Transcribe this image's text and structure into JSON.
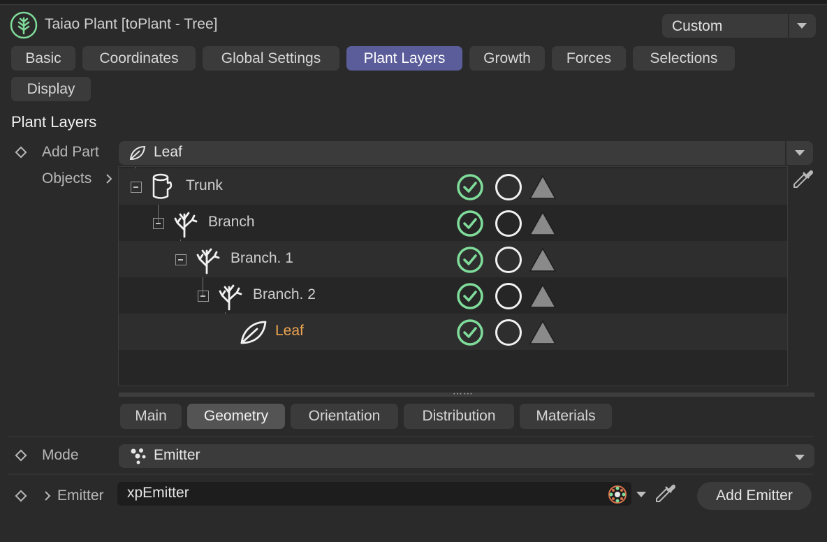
{
  "header": {
    "title": "Taiao Plant [toPlant - Tree]",
    "preset": "Custom"
  },
  "tabs": [
    {
      "label": "Basic",
      "active": false
    },
    {
      "label": "Coordinates",
      "active": false
    },
    {
      "label": "Global Settings",
      "active": false
    },
    {
      "label": "Plant Layers",
      "active": true
    },
    {
      "label": "Growth",
      "active": false
    },
    {
      "label": "Forces",
      "active": false
    },
    {
      "label": "Selections",
      "active": false
    },
    {
      "label": "Display",
      "active": false
    }
  ],
  "section": {
    "title": "Plant Layers"
  },
  "add_part": {
    "label": "Add Part",
    "value": "Leaf"
  },
  "objects": {
    "label": "Objects",
    "items": [
      {
        "name": "Trunk",
        "icon": "trunk-icon",
        "selected": false
      },
      {
        "name": "Branch",
        "icon": "branch-icon",
        "selected": false
      },
      {
        "name": "Branch. 1",
        "icon": "branch-icon",
        "selected": false
      },
      {
        "name": "Branch. 2",
        "icon": "branch-icon",
        "selected": false
      },
      {
        "name": "Leaf",
        "icon": "leaf-icon",
        "selected": true
      }
    ]
  },
  "sub_tabs": [
    {
      "label": "Main",
      "active": false
    },
    {
      "label": "Geometry",
      "active": true
    },
    {
      "label": "Orientation",
      "active": false
    },
    {
      "label": "Distribution",
      "active": false
    },
    {
      "label": "Materials",
      "active": false
    }
  ],
  "mode": {
    "label": "Mode",
    "value": "Emitter"
  },
  "emitter": {
    "label": "Emitter",
    "value": "xpEmitter",
    "add_button": "Add Emitter"
  },
  "colors": {
    "accent_tab": "#5a5d99",
    "selected_item": "#f0a552",
    "check_green": "#7fdc9a"
  }
}
